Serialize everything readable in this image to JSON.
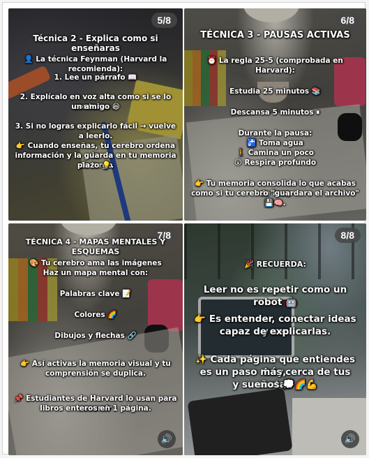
{
  "tiles": [
    {
      "counter": "5/8",
      "lines": [
        "Técnica 2 - Explica como si enseñaras",
        "👤 La técnica Feynman (Harvard la recomienda):",
        "1. Lee un párrafo 📖",
        "2. Explícalo en voz alta como si se lo contaras a",
        "un amigo 😆",
        "3. Si no logras explicarlo fácil → vuelve a leerlo.",
        "👉 Cuando enseñas, tu cerebro ordena la",
        "información y la guarda en tu memoria de largo",
        "plazo 💡."
      ]
    },
    {
      "counter": "6/8",
      "lines": [
        "TÉCNICA 3 - PAUSAS ACTIVAS",
        "⏰ La regla 25-5 (comprobada en",
        "Harvard):",
        "Estudia 25 minutos 📚",
        "Descansa 5 minutos ⏸",
        "Durante la pausa:",
        "🚰 Toma agua",
        "🚶 Camina un poco",
        "😮 Respira profundo",
        "👉 Tu memoria consolida lo que acabas de leer,",
        "como si tu cerebro \"guardara el archivo\" 💾🧠."
      ]
    },
    {
      "counter": "7/8",
      "lines": [
        "TÉCNICA 4 - MAPAS MENTALES Y ESQUEMAS",
        "🎨 Tu cerebro ama las imágenes",
        "Haz un mapa mental con:",
        "Palabras clave 📝",
        "Colores 🌈",
        "Dibujos y flechas 🔗",
        "👉 Así activas la memoria visual y tu",
        "comprensión se duplica.",
        "📌 Estudiantes de Harvard lo usan para resumir",
        "libros enteros en 1 página."
      ]
    },
    {
      "counter": "8/8",
      "lines": [
        "🎉 RECUERDA:",
        "Leer no es repetir como un robot 🤖",
        "👉 Es entender, conectar ideas y ser",
        "capaz de explicarlas.",
        "✨ Cada página que entiendes hoy,",
        "es un paso más cerca de tus metas",
        "y sueños 💭🌈💪"
      ]
    }
  ],
  "icons": {
    "sound": "speaker-icon"
  }
}
